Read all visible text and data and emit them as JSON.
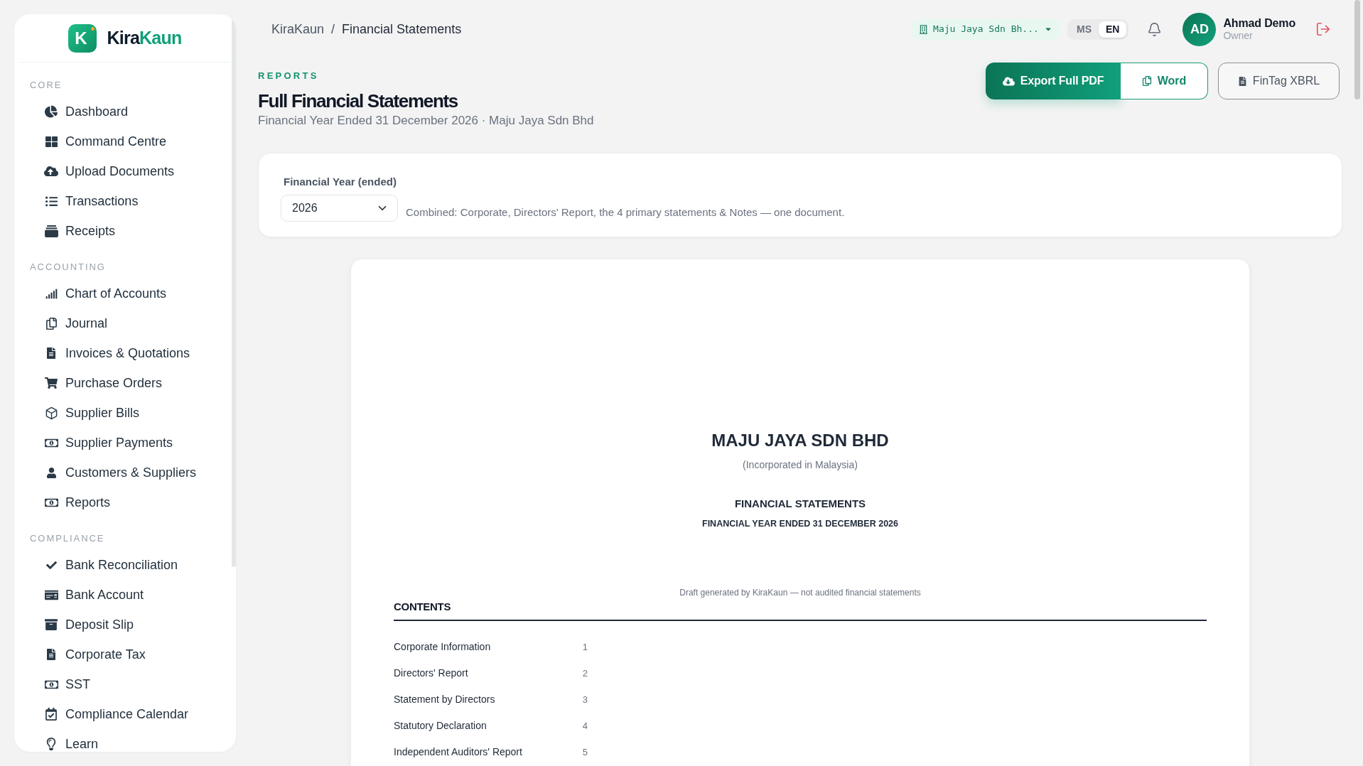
{
  "sidebar": {
    "brand": {
      "mark": "K",
      "name": {
        "first": "Kira",
        "second": "Kaun"
      }
    },
    "sections": [
      {
        "title": "CORE",
        "items": [
          {
            "label": "Dashboard"
          },
          {
            "label": "Command Centre"
          },
          {
            "label": "Upload Documents"
          },
          {
            "label": "Transactions"
          },
          {
            "label": "Receipts"
          }
        ]
      },
      {
        "title": "ACCOUNTING",
        "items": [
          {
            "label": "Chart of Accounts"
          },
          {
            "label": "Journal"
          },
          {
            "label": "Invoices & Quotations"
          },
          {
            "label": "Purchase Orders"
          },
          {
            "label": "Supplier Bills"
          },
          {
            "label": "Supplier Payments"
          },
          {
            "label": "Customers & Suppliers"
          },
          {
            "label": "Reports"
          }
        ]
      },
      {
        "title": "COMPLIANCE",
        "items": [
          {
            "label": "Bank Reconciliation"
          },
          {
            "label": "Bank Account"
          },
          {
            "label": "Deposit Slip"
          },
          {
            "label": "Corporate Tax"
          },
          {
            "label": "SST"
          },
          {
            "label": "Compliance Calendar"
          },
          {
            "label": "Learn"
          }
        ]
      }
    ]
  },
  "top_bar": {
    "breadcrumb": {
      "items": [
        "KiraKaun",
        "Financial Statements"
      ],
      "separator": "/"
    },
    "company_selector": {
      "value": "Maju Jaya Sdn Bh..."
    },
    "languages": [
      {
        "label": "MS",
        "selected": false
      },
      {
        "label": "EN",
        "selected": true
      }
    ],
    "user": {
      "initials": "AD",
      "name": "Ahmad Demo",
      "role": "Owner"
    }
  },
  "page_header": {
    "eyebrow": "REPORTS",
    "title": "Full Financial Statements",
    "subtitle": "Financial Year Ended 31 December 2026 · Maju Jaya Sdn Bhd",
    "actions": [
      {
        "label": "Export Full PDF",
        "kind": "primary"
      },
      {
        "label": "Word",
        "kind": "secondary"
      },
      {
        "label": "FinTag XBRL",
        "kind": "outline"
      }
    ]
  },
  "filter": {
    "label": "Financial Year (ended)",
    "value": "2026",
    "note": "Combined: Corporate, Directors' Report, the 4 primary statements & Notes — one document."
  },
  "document": {
    "company": "MAJU JAYA SDN BHD",
    "incorporation": "(Incorporated in Malaysia)",
    "heading": "FINANCIAL STATEMENTS",
    "period": "FINANCIAL YEAR ENDED 31 DECEMBER 2026",
    "draft_note": "Draft generated by KiraKaun — not audited financial statements",
    "contents": {
      "title": "CONTENTS",
      "entries": [
        {
          "title": "Corporate Information",
          "page": "1"
        },
        {
          "title": "Directors' Report",
          "page": "2"
        },
        {
          "title": "Statement by Directors",
          "page": "3"
        },
        {
          "title": "Statutory Declaration",
          "page": "4"
        },
        {
          "title": "Independent Auditors' Report",
          "page": "5"
        }
      ]
    }
  }
}
